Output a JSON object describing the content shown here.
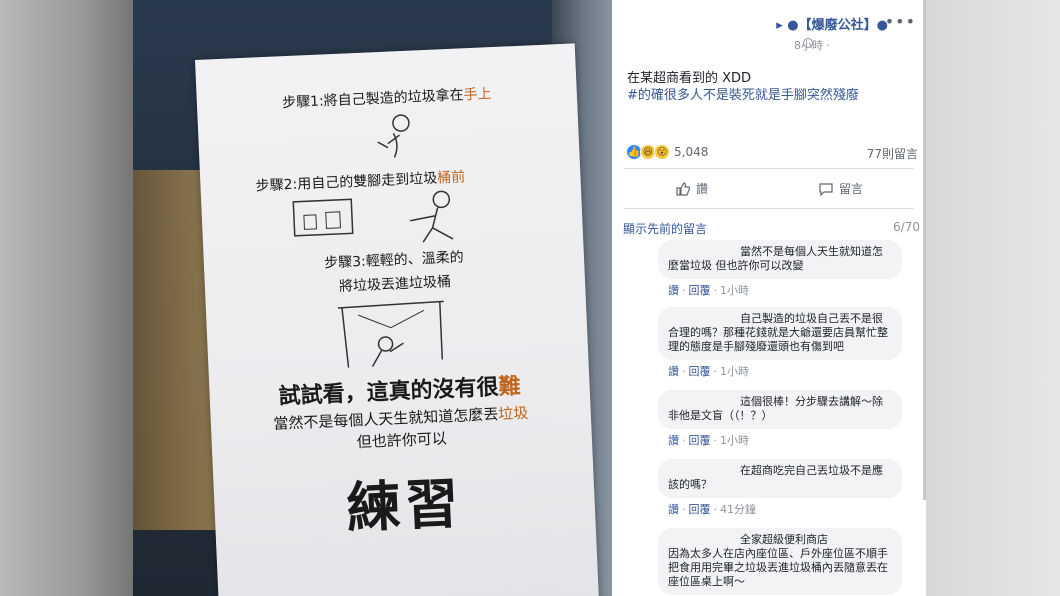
{
  "post": {
    "page_name": "▸ ●【爆廢公社】●",
    "time": "8小時 · ",
    "more": "•••",
    "text_line1": "在某超商看到的 XDD",
    "text_line2": "#的確很多人不是裝死就是手腳突然殘廢",
    "reaction_count": "5,048",
    "comment_count": "77則留言",
    "like_label": "讚",
    "comment_label": "留言",
    "prev_comments": "顯示先前的留言",
    "page_indicator": "6/70"
  },
  "comments": [
    {
      "text": "當然不是每個人天生就知道怎麼當垃圾 但也許你可以改變",
      "like": "讚",
      "reply": "回覆",
      "time": "1小時"
    },
    {
      "text": "自己製造的垃圾自己丟不是很合理的嗎？那種花錢就是大爺還要店員幫忙整理的態度是手腳殘廢還頭也有傷到吧",
      "like": "讚",
      "reply": "回覆",
      "time": "1小時"
    },
    {
      "text": "這個很棒！分步驟去講解～除非他是文盲（（！？）",
      "like": "讚",
      "reply": "回覆",
      "time": "1小時"
    },
    {
      "text": "在超商吃完自己丟垃圾不是應該的嗎？",
      "like": "讚",
      "reply": "回覆",
      "time": "41分鐘"
    },
    {
      "text_head": "全家超級便利商店",
      "text": "因為太多人在店內座位區、戶外座位區不順手把食用用完畢之垃圾丟進垃圾桶內丟隨意丟在座位區桌上啊～"
    }
  ],
  "sign": {
    "step1_a": "步驟1:將自己製造的垃圾拿在",
    "step1_b": "手上",
    "step2_a": "步驟2:用自己的雙腳走到垃圾",
    "step2_b": "桶前",
    "step3_a": "步驟3:輕輕的、溫柔的",
    "step3_b": "將垃圾丟進垃圾桶",
    "try_a": "試試看，這真的沒有很",
    "try_b": "難",
    "line_a": "當然不是每個人天生就知道怎麼丟",
    "line_b": "垃圾",
    "line_c": "但也許你可以",
    "practice": "練習"
  }
}
